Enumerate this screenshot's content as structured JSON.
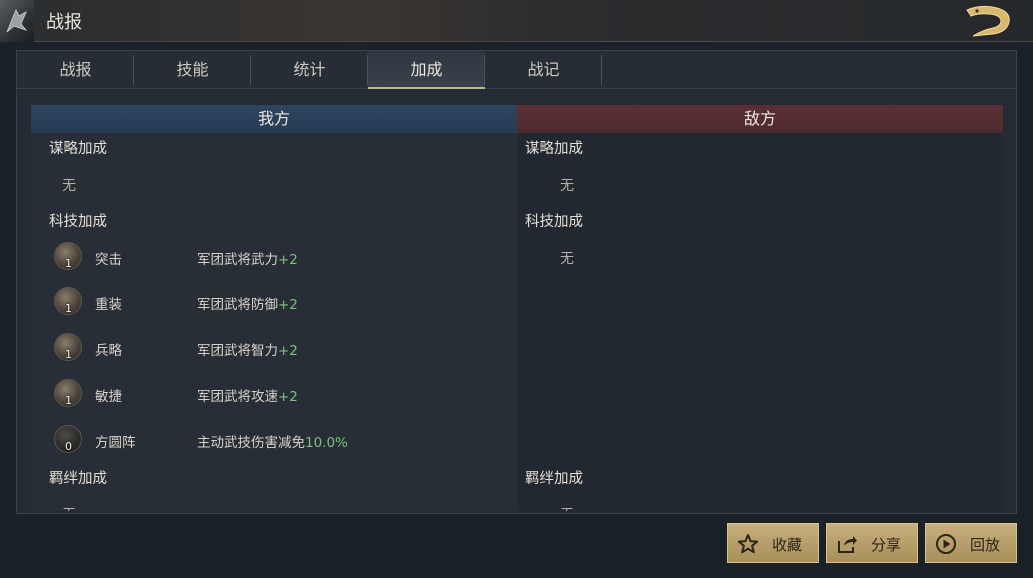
{
  "window": {
    "title": "战报"
  },
  "tabs": [
    {
      "label": "战报",
      "active": false
    },
    {
      "label": "技能",
      "active": false
    },
    {
      "label": "统计",
      "active": false
    },
    {
      "label": "加成",
      "active": true
    },
    {
      "label": "战记",
      "active": false
    }
  ],
  "columns": {
    "ours": "我方",
    "enemy": "敌方"
  },
  "ours": {
    "strategy": {
      "title": "谋略加成",
      "value": "无"
    },
    "tech": {
      "title": "科技加成",
      "items": [
        {
          "icon": "assault-tech-icon",
          "level": "1",
          "name": "突击",
          "effect": "军团武将武力",
          "value": "+2"
        },
        {
          "icon": "heavy-armor-tech-icon",
          "level": "1",
          "name": "重装",
          "effect": "军团武将防御",
          "value": "+2"
        },
        {
          "icon": "strategy-tech-icon",
          "level": "1",
          "name": "兵略",
          "effect": "军团武将智力",
          "value": "+2"
        },
        {
          "icon": "agility-tech-icon",
          "level": "1",
          "name": "敏捷",
          "effect": "军团武将攻速",
          "value": "+2"
        },
        {
          "icon": "square-formation-tech-icon",
          "level": "0",
          "name": "方圆阵",
          "effect": "主动武技伤害减免",
          "value": "10.0%"
        }
      ]
    },
    "bond": {
      "title": "羁绊加成",
      "value": "无"
    }
  },
  "enemy": {
    "strategy": {
      "title": "谋略加成",
      "value": "无"
    },
    "tech": {
      "title": "科技加成",
      "value": "无"
    },
    "bond": {
      "title": "羁绊加成",
      "value": "无"
    }
  },
  "buttons": {
    "favorite": "收藏",
    "share": "分享",
    "replay": "回放"
  },
  "colors": {
    "accent_gold": "#c9b98a",
    "ours_header": "#2d4560",
    "enemy_header": "#5a2f33",
    "bonus_green": "#7fc07f"
  }
}
